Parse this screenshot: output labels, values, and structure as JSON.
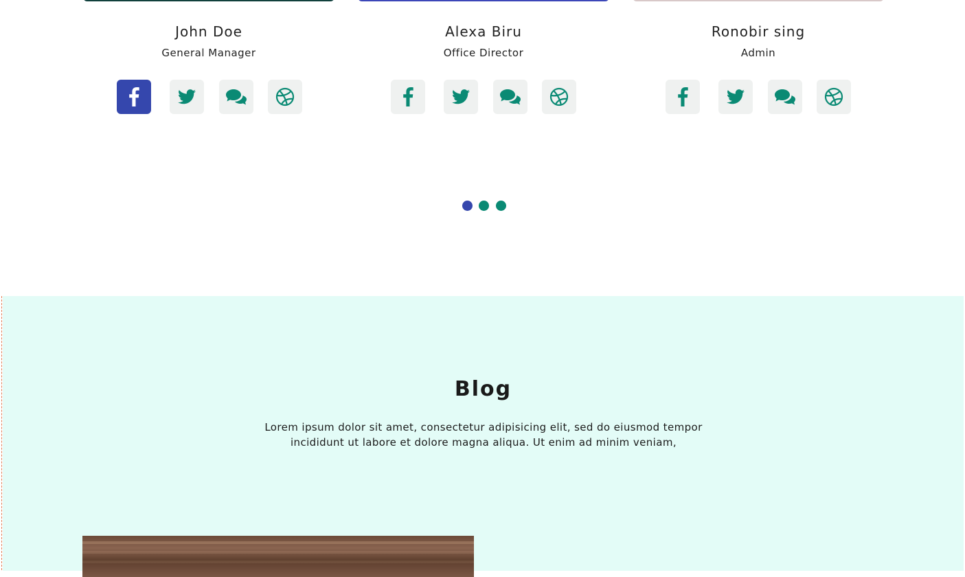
{
  "team": {
    "members": [
      {
        "name": "John Doe",
        "role": "General Manager",
        "strip_color": "#10403c"
      },
      {
        "name": "Alexa Biru",
        "role": "Office Director",
        "strip_color": "#3b46b8"
      },
      {
        "name": "Ronobir sing",
        "role": "Admin",
        "strip_color": "#d8c8c8"
      }
    ],
    "social_icons": [
      "facebook-icon",
      "twitter-icon",
      "chat-icon",
      "dribbble-icon"
    ],
    "colors": {
      "icon": "#0a8a74",
      "active_bg": "#3547ad",
      "icon_bg": "#eff1f0"
    },
    "carousel": {
      "count": 3,
      "active": 0
    }
  },
  "blog": {
    "title": "Blog",
    "description_line1": "Lorem ipsum dolor sit amet, consectetur adipisicing elit, sed do eiusmod tempor",
    "description_line2": "incididunt ut labore et dolore magna aliqua. Ut enim ad minim veniam,",
    "background": "#e3fcf7"
  }
}
